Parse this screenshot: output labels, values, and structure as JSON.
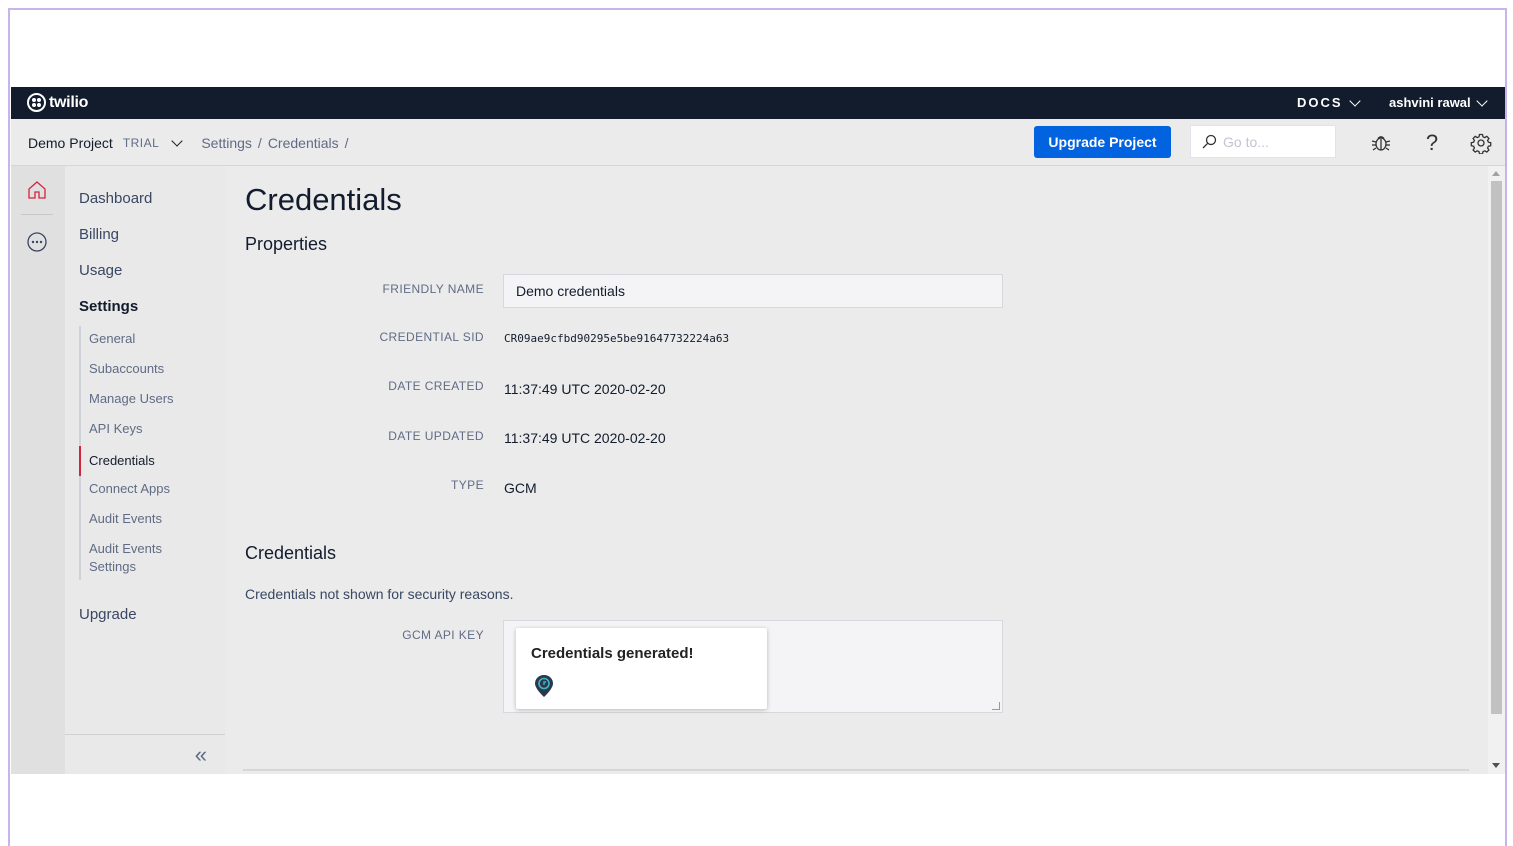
{
  "topbar": {
    "logo_text": "twilio",
    "docs_label": "DOCS",
    "user_name": "ashvini rawal"
  },
  "subbar": {
    "project_name": "Demo Project",
    "project_badge": "TRIAL",
    "breadcrumb": [
      "Settings",
      "/",
      "Credentials",
      "/"
    ],
    "upgrade_label": "Upgrade Project",
    "goto_placeholder": "Go to..."
  },
  "icons": {
    "home": "home-icon",
    "more": "more-icon",
    "debug": "bug-icon",
    "help": "help-icon",
    "settings": "gear-icon"
  },
  "sidebar": {
    "top_items": [
      "Dashboard",
      "Billing",
      "Usage",
      "Settings"
    ],
    "settings_items": [
      "General",
      "Subaccounts",
      "Manage Users",
      "API Keys",
      "Credentials",
      "Connect Apps",
      "Audit Events",
      "Audit Events Settings"
    ],
    "upgrade_label": "Upgrade",
    "collapse_glyph": "«"
  },
  "main": {
    "title": "Credentials",
    "properties_heading": "Properties",
    "fields": {
      "friendly_name_label": "FRIENDLY NAME",
      "friendly_name_value": "Demo credentials",
      "sid_label": "CREDENTIAL SID",
      "sid_value": "CR09ae9cfbd90295e5be91647732224a63",
      "created_label": "DATE CREATED",
      "created_value": "11:37:49 UTC 2020-02-20",
      "updated_label": "DATE UPDATED",
      "updated_value": "11:37:49 UTC 2020-02-20",
      "type_label": "TYPE",
      "type_value": "GCM"
    },
    "credentials_heading": "Credentials",
    "credentials_note": "Credentials not shown for security reasons.",
    "api_key_label": "GCM API KEY",
    "toast_text": "Credentials generated!"
  },
  "colors": {
    "navbar": "#121c2d",
    "primary_button": "#0263e0",
    "active_accent": "#d3243e"
  }
}
